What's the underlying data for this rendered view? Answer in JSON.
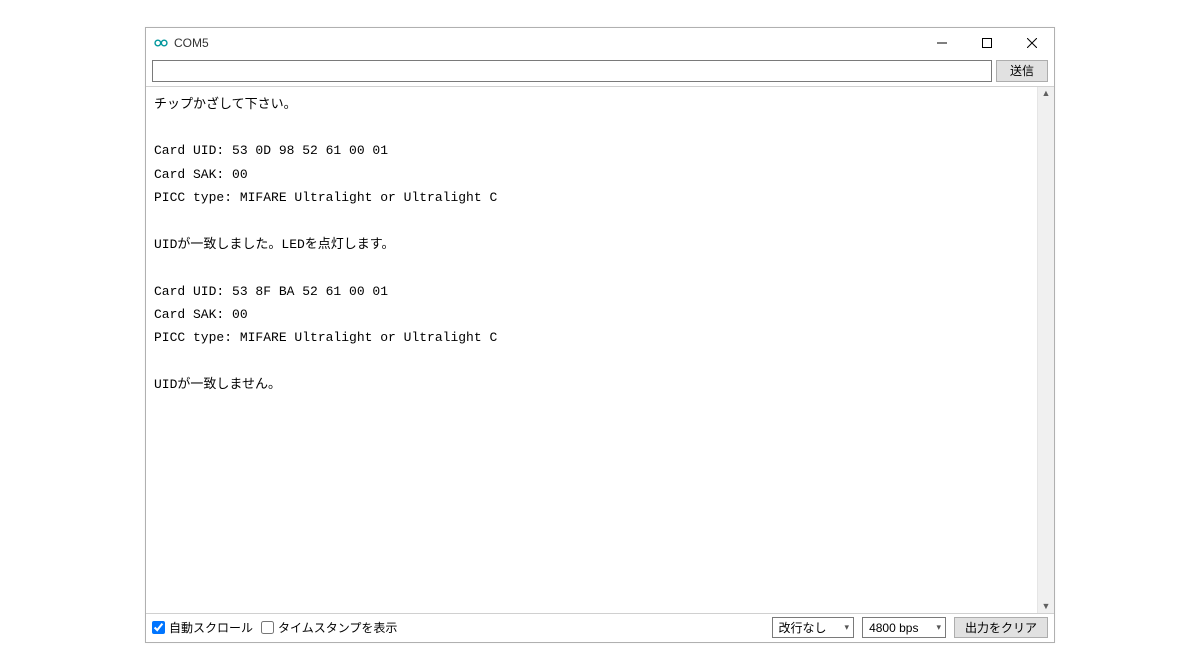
{
  "title": "COM5",
  "input": {
    "value": "",
    "placeholder": ""
  },
  "send_label": "送信",
  "console_lines": [
    "チップかざして下さい。",
    "",
    "Card UID: 53 0D 98 52 61 00 01",
    "Card SAK: 00",
    "PICC type: MIFARE Ultralight or Ultralight C",
    "",
    "UIDが一致しました。LEDを点灯します。",
    "",
    "Card UID: 53 8F BA 52 61 00 01",
    "Card SAK: 00",
    "PICC type: MIFARE Ultralight or Ultralight C",
    "",
    "UIDが一致しません。"
  ],
  "bottom": {
    "autoscroll": {
      "label": "自動スクロール",
      "checked": true
    },
    "timestamp": {
      "label": "タイムスタンプを表示",
      "checked": false
    },
    "line_ending": "改行なし",
    "baud": "4800 bps",
    "clear_label": "出力をクリア"
  }
}
